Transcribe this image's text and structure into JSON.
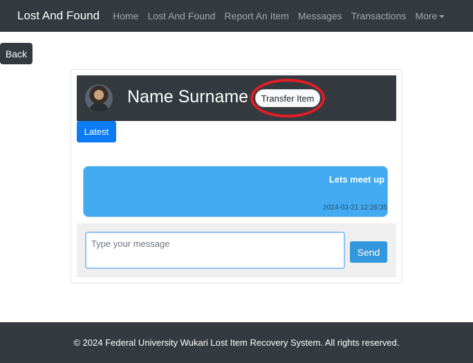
{
  "navbar": {
    "brand": "Lost And Found",
    "links": [
      "Home",
      "Lost And Found",
      "Report An Item",
      "Messages",
      "Transactions"
    ],
    "more_label": "More"
  },
  "back_label": "Back",
  "chat": {
    "contact_name": "Name Surname",
    "transfer_label": "Transfer Item",
    "latest_label": "Latest",
    "messages": [
      {
        "text": "Lets meet up",
        "time": "2024-03-21 12:26:35"
      }
    ],
    "input_placeholder": "Type your message",
    "send_label": "Send"
  },
  "footer": {
    "text": "© 2024 Federal University Wukari Lost Item Recovery System. All rights reserved."
  },
  "colors": {
    "navbar_bg": "#343a40",
    "latest_btn": "#0d7cf2",
    "message_bubble": "#41aaf1",
    "send_btn": "#3397db",
    "highlight_ring": "#e31e24"
  }
}
